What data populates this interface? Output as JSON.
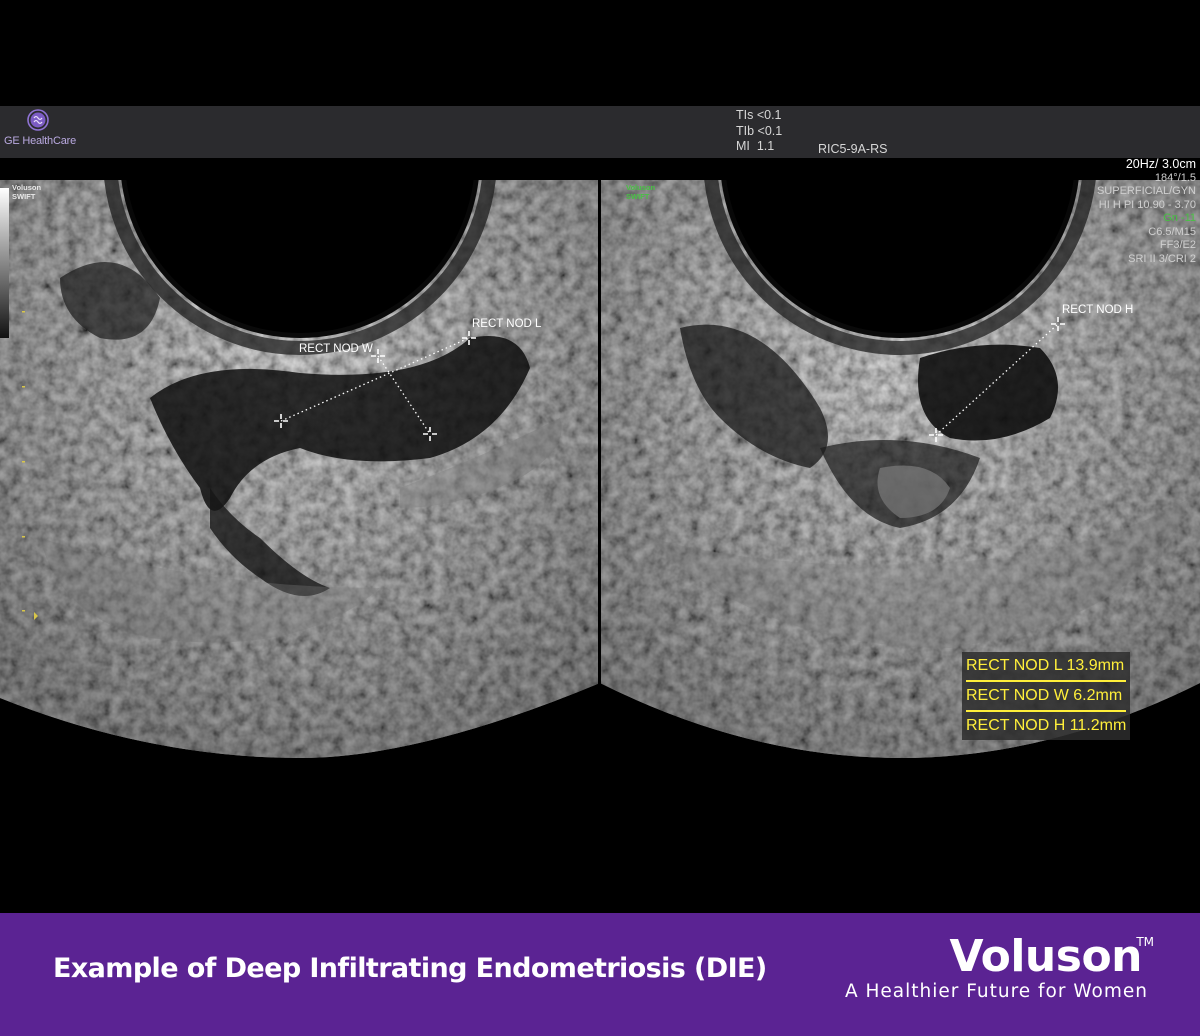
{
  "header": {
    "logo_text": "GE HealthCare",
    "tis": "TIs <0.1",
    "tib": "TIb <0.1",
    "mi": "MI  1.1",
    "probe": "RIC5-9A-RS"
  },
  "left_image": {
    "brand_line1": "Voluson",
    "brand_line2": "SWIFT",
    "label_w": "RECT NOD W",
    "label_l": "RECT NOD L"
  },
  "right_image": {
    "brand_line1": "Voluson",
    "brand_line2": "SWIFT",
    "label_h": "RECT NOD H"
  },
  "settings": {
    "frame": "20Hz/ 3.0cm",
    "angle": "184°/1.5",
    "preset": "SUPERFICIAL/GYN",
    "freq": "HI H PI 10.90 - 3.70",
    "gain": "Gn -11",
    "c_m": "C6.5/M15",
    "ff_e": "FF3/E2",
    "sri": "SRI II 3/CRI 2"
  },
  "measurements": [
    "RECT NOD L 13.9mm",
    "RECT NOD W 6.2mm",
    "RECT NOD H 11.2mm"
  ],
  "footer": {
    "caption": "Example of Deep Infiltrating Endometriosis (DIE)",
    "brand": "Voluson",
    "trademark": "TM",
    "tagline": "A Healthier Future for Women"
  },
  "colors": {
    "footer_bg": "#5b2393",
    "measurement_text": "#ffef3a",
    "brand_green": "#47c243",
    "logo_purple": "#7c5cc4"
  }
}
